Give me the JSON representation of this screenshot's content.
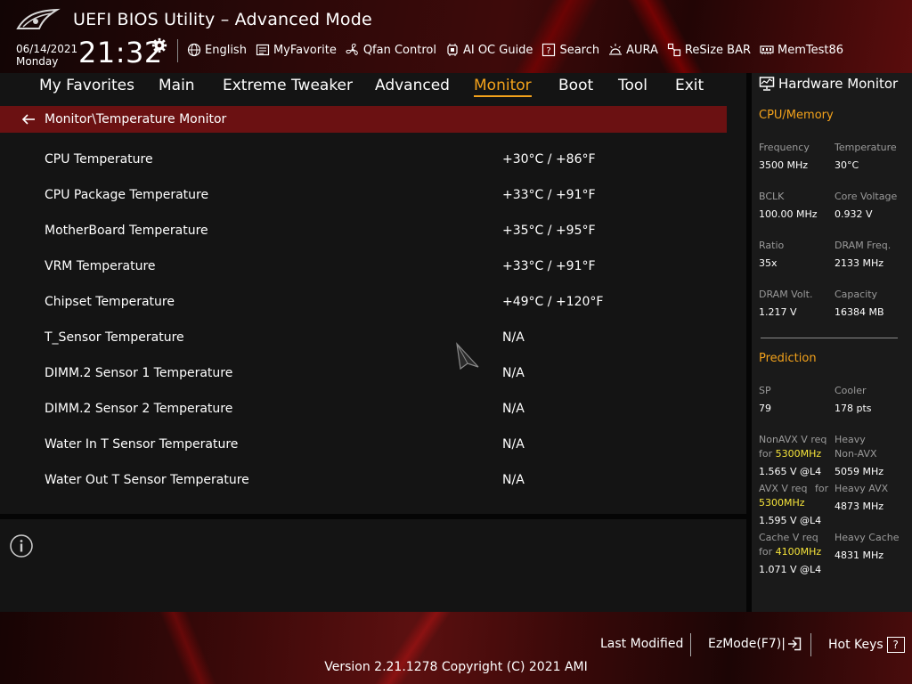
{
  "app": {
    "title": "UEFI BIOS Utility – Advanced Mode"
  },
  "header": {
    "date": "06/14/2021",
    "day": "Monday",
    "time": "21:32",
    "tools": [
      {
        "label": "English",
        "icon": "globe-icon"
      },
      {
        "label": "MyFavorite",
        "icon": "favorite-list-icon"
      },
      {
        "label": "Qfan Control",
        "icon": "fan-icon"
      },
      {
        "label": "AI OC Guide",
        "icon": "ai-chip-icon"
      },
      {
        "label": "Search",
        "icon": "search-question-icon"
      },
      {
        "label": "AURA",
        "icon": "aura-light-icon"
      },
      {
        "label": "ReSize BAR",
        "icon": "resize-bar-icon"
      },
      {
        "label": "MemTest86",
        "icon": "memory-icon"
      }
    ]
  },
  "nav": {
    "tabs": [
      "My Favorites",
      "Main",
      "Extreme Tweaker",
      "Advanced",
      "Monitor",
      "Boot",
      "Tool",
      "Exit"
    ],
    "active": "Monitor"
  },
  "breadcrumb": "Monitor\\Temperature Monitor",
  "rows": [
    {
      "label": "CPU Temperature",
      "value": "+30°C / +86°F"
    },
    {
      "label": "CPU Package Temperature",
      "value": "+33°C / +91°F"
    },
    {
      "label": "MotherBoard Temperature",
      "value": "+35°C / +95°F"
    },
    {
      "label": "VRM Temperature",
      "value": "+33°C / +91°F"
    },
    {
      "label": "Chipset Temperature",
      "value": "+49°C / +120°F"
    },
    {
      "label": "T_Sensor Temperature",
      "value": " N/A"
    },
    {
      "label": "DIMM.2 Sensor 1 Temperature",
      "value": " N/A"
    },
    {
      "label": "DIMM.2 Sensor 2 Temperature",
      "value": " N/A"
    },
    {
      "label": "Water In T Sensor Temperature",
      "value": " N/A"
    },
    {
      "label": "Water Out T Sensor Temperature",
      "value": " N/A"
    }
  ],
  "hw": {
    "title": "Hardware Monitor",
    "cpu_section": "CPU/Memory",
    "cpu_stats": [
      {
        "label": "Frequency",
        "value": "3500 MHz"
      },
      {
        "label": "Temperature",
        "value": "30°C"
      },
      {
        "label": "BCLK",
        "value": "100.00 MHz"
      },
      {
        "label": "Core Voltage",
        "value": "0.932 V"
      },
      {
        "label": "Ratio",
        "value": "35x"
      },
      {
        "label": "DRAM Freq.",
        "value": "2133 MHz"
      },
      {
        "label": "DRAM Volt.",
        "value": "1.217 V"
      },
      {
        "label": "Capacity",
        "value": "16384 MB"
      }
    ],
    "pred_section": "Prediction",
    "sp": {
      "label": "SP",
      "value": "79"
    },
    "cooler": {
      "label": "Cooler",
      "value": "178 pts"
    },
    "nonavx": {
      "label1": "NonAVX V req",
      "label2": "for ",
      "freq": "5300MHz",
      "value": "1.565 V @L4"
    },
    "heavy_nonavx": {
      "label1": "Heavy",
      "label2": "Non-AVX",
      "value": "5059 MHz"
    },
    "avx": {
      "label1": "AVX V req",
      "label_for": "for",
      "freq": "5300MHz",
      "value": "1.595 V @L4"
    },
    "heavy_avx": {
      "label": "Heavy AVX",
      "value": "4873 MHz"
    },
    "cache": {
      "label1": "Cache V req",
      "label2": "for ",
      "freq": "4100MHz",
      "value": "1.071 V @L4"
    },
    "heavy_cache": {
      "label": "Heavy Cache",
      "value": "4831 MHz"
    }
  },
  "footer": {
    "last_modified": "Last Modified",
    "ezmode": "EzMode(F7)|",
    "hotkeys": "Hot Keys",
    "hotkeys_glyph": "?",
    "version": "Version 2.21.1278 Copyright (C) 2021 AMI"
  },
  "colors": {
    "accent": "#f3a21b",
    "highlight": "#f5e33a",
    "breadcrumb_bg": "#6b1112"
  }
}
